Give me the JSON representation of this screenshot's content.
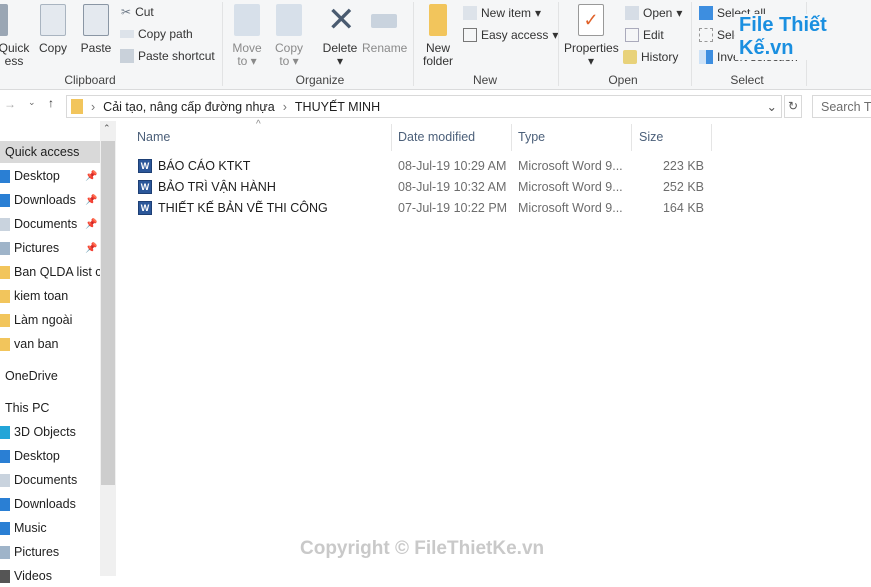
{
  "ribbon": {
    "clipboard": {
      "pin_label": "Quick",
      "pin_label2": "ess",
      "copy": "Copy",
      "paste": "Paste",
      "cut": "Cut",
      "copy_path": "Copy path",
      "paste_shortcut": "Paste shortcut",
      "group": "Clipboard"
    },
    "organize": {
      "move_to": "Move",
      "move_to2": "to",
      "copy_to": "Copy",
      "copy_to2": "to",
      "delete": "Delete",
      "rename": "Rename",
      "group": "Organize"
    },
    "new": {
      "new_folder": "New",
      "new_folder2": "folder",
      "new_item": "New item",
      "easy_access": "Easy access",
      "group": "New"
    },
    "open": {
      "properties": "Properties",
      "open": "Open",
      "edit": "Edit",
      "history": "History",
      "group": "Open"
    },
    "select": {
      "select_all": "Select all",
      "select_none": "Select none",
      "invert": "Invert selection",
      "group": "Select"
    }
  },
  "address": {
    "crumbs": [
      "Cải tạo, nâng cấp đường nhựa",
      "THUYẾT MINH"
    ],
    "search_placeholder": "Search THUYẾT MINH"
  },
  "nav": {
    "items": [
      {
        "label": "Quick access",
        "type": "header"
      },
      {
        "label": "Desktop",
        "pinned": true
      },
      {
        "label": "Downloads",
        "pinned": true
      },
      {
        "label": "Documents",
        "pinned": true
      },
      {
        "label": "Pictures",
        "pinned": true
      },
      {
        "label": "Ban QLDA list ch"
      },
      {
        "label": "kiem toan"
      },
      {
        "label": "Làm ngoài"
      },
      {
        "label": "van ban"
      },
      {
        "label": "OneDrive",
        "type": "header"
      },
      {
        "label": "This PC",
        "type": "header"
      },
      {
        "label": "3D Objects"
      },
      {
        "label": "Desktop"
      },
      {
        "label": "Documents"
      },
      {
        "label": "Downloads"
      },
      {
        "label": "Music"
      },
      {
        "label": "Pictures"
      },
      {
        "label": "Videos"
      }
    ]
  },
  "columns": {
    "name": "Name",
    "date": "Date modified",
    "type": "Type",
    "size": "Size"
  },
  "files": [
    {
      "name": "BÁO CÁO KTKT",
      "date": "08-Jul-19 10:29 AM",
      "type": "Microsoft Word 9...",
      "size": "223 KB"
    },
    {
      "name": "BẢO TRÌ VẬN HÀNH",
      "date": "08-Jul-19 10:32 AM",
      "type": "Microsoft Word 9...",
      "size": "252 KB"
    },
    {
      "name": "THIẾT KẾ BẢN VẼ THI CÔNG",
      "date": "07-Jul-19 10:22 PM",
      "type": "Microsoft Word 9...",
      "size": "164 KB"
    }
  ],
  "watermark": {
    "text": "Copyright © FileThietKe.vn",
    "logo": "File Thiết Kế.vn"
  }
}
